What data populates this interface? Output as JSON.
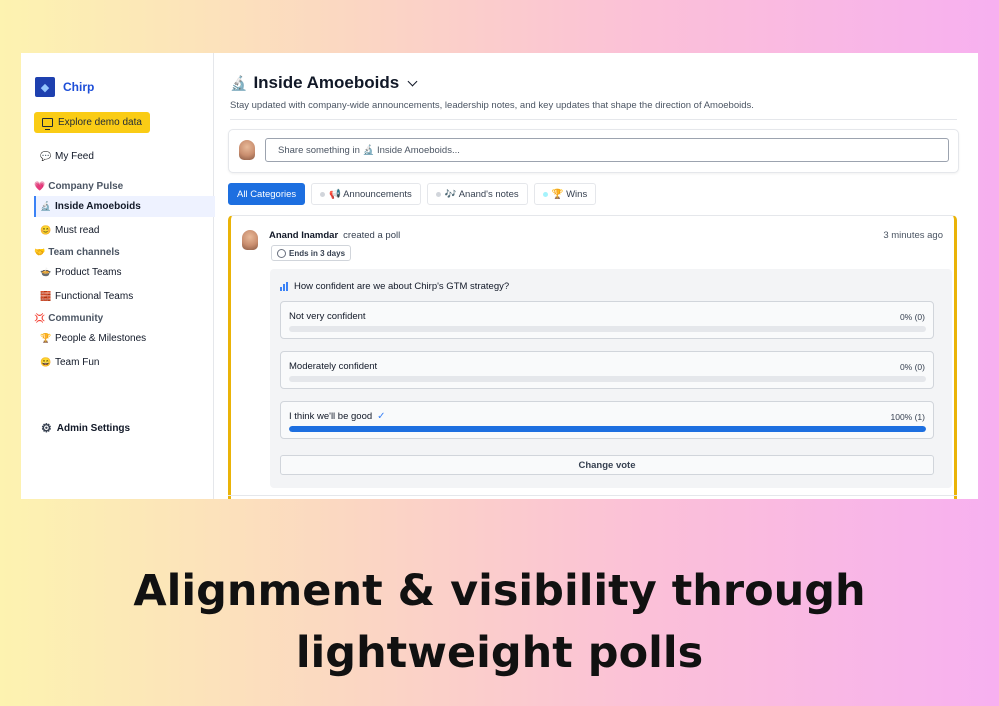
{
  "sidebar": {
    "brand": "Chirp",
    "brand_icon": "bird-icon",
    "demo_button": "Explore demo data",
    "my_feed": {
      "emoji": "💬",
      "label": "My Feed"
    },
    "sections": [
      {
        "emoji": "💗",
        "label": "Company Pulse"
      },
      {
        "emoji": "🤝",
        "label": "Team channels"
      },
      {
        "emoji": "💢",
        "label": "Community"
      }
    ],
    "items": [
      {
        "emoji": "🔬",
        "label": "Inside Amoeboids"
      },
      {
        "emoji": "😊",
        "label": "Must read"
      },
      {
        "emoji": "🍲",
        "label": "Product Teams"
      },
      {
        "emoji": "🧱",
        "label": "Functional Teams"
      },
      {
        "emoji": "🏆",
        "label": "People & Milestones"
      },
      {
        "emoji": "😄",
        "label": "Team Fun"
      }
    ],
    "active_item": "Inside Amoeboids",
    "admin": "Admin Settings"
  },
  "header": {
    "emoji": "🔬",
    "title": "Inside Amoeboids",
    "subtitle": "Stay updated with company-wide announcements, leadership notes, and key updates that shape the direction of Amoeboids."
  },
  "composer": {
    "placeholder": "Share something in 🔬 Inside Amoeboids..."
  },
  "tabs": [
    {
      "label": "All Categories",
      "active": true
    },
    {
      "label": "📢 Announcements"
    },
    {
      "label": "🎶 Anand's notes"
    },
    {
      "label": "🏆 Wins"
    }
  ],
  "post": {
    "author": "Anand Inamdar",
    "action": "created a poll",
    "time": "3 minutes ago",
    "ends": "Ends in 3 days",
    "question": "How confident are we about Chirp's GTM strategy?",
    "options": [
      {
        "label": "Not very confident",
        "pct_text": "0% (0)",
        "fraction": 0
      },
      {
        "label": "Moderately confident",
        "pct_text": "0% (0)",
        "fraction": 0
      },
      {
        "label": "I think we'll be good",
        "pct_text": "100% (1)",
        "fraction": 1,
        "selected": true
      }
    ],
    "change_vote": "Change vote"
  },
  "caption": "Alignment & visibility through lightweight polls",
  "colors": {
    "accent": "#1d6fe0",
    "highlight": "#eab308",
    "demo_button": "#facc15"
  }
}
